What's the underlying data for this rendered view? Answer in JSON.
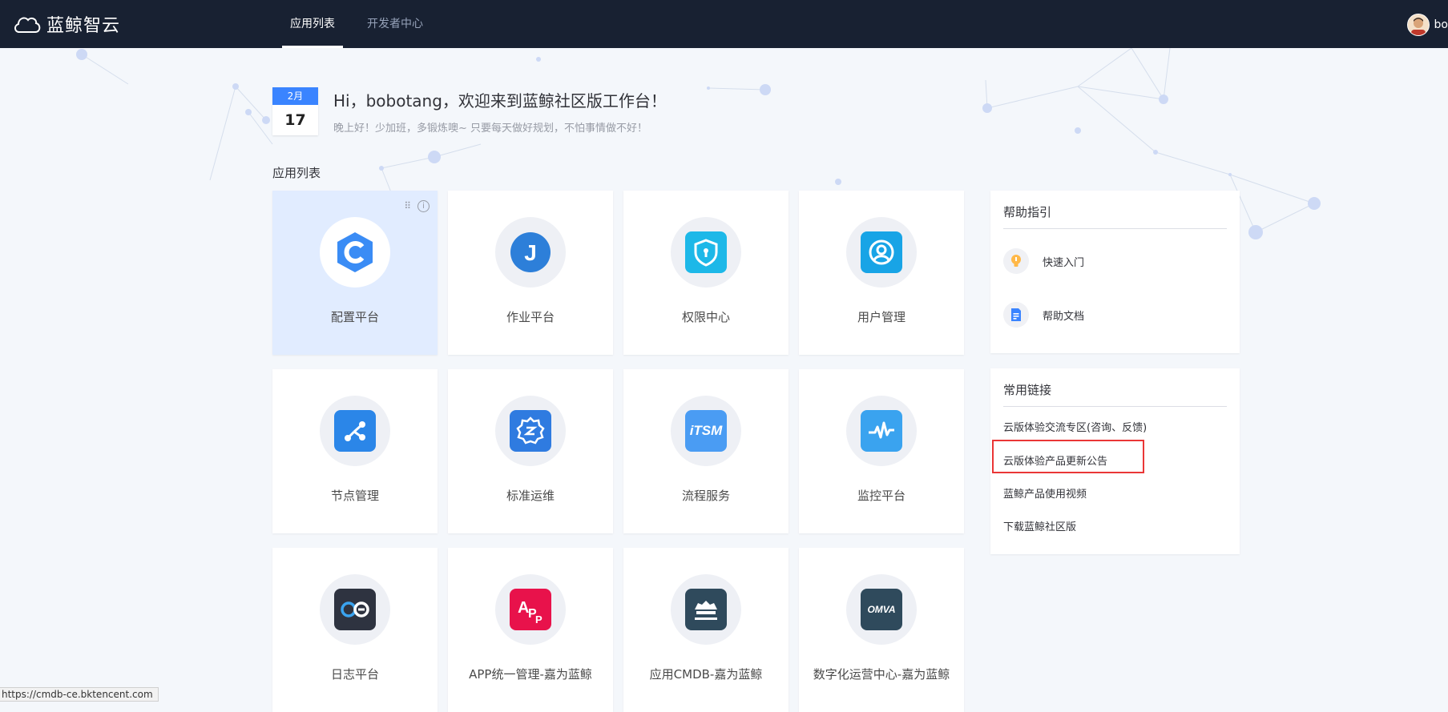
{
  "brand": {
    "name": "蓝鲸智云"
  },
  "nav": {
    "tabs": [
      {
        "label": "应用列表",
        "active": true
      },
      {
        "label": "开发者中心",
        "active": false
      }
    ]
  },
  "user": {
    "name": "bo"
  },
  "greeting": {
    "month": "2月",
    "day": "17",
    "title": "Hi，bobotang，欢迎来到蓝鲸社区版工作台！",
    "subtitle": "晚上好！少加班，多锻炼噢~ 只要每天做好规划，不怕事情做不好！"
  },
  "apps": {
    "section_title": "应用列表",
    "items": [
      {
        "name": "配置平台",
        "icon": "cmdb-icon",
        "color": "#2f8cf8"
      },
      {
        "name": "作业平台",
        "icon": "job-icon",
        "color": "#2d7fd9"
      },
      {
        "name": "权限中心",
        "icon": "iam-shield-icon",
        "color": "#1db8e8"
      },
      {
        "name": "用户管理",
        "icon": "user-manage-icon",
        "color": "#18a4e6"
      },
      {
        "name": "节点管理",
        "icon": "node-manage-icon",
        "color": "#2b86e8"
      },
      {
        "name": "标准运维",
        "icon": "sops-icon",
        "color": "#2f7be0"
      },
      {
        "name": "流程服务",
        "icon": "itsm-icon",
        "color": "#4a9cf3"
      },
      {
        "name": "监控平台",
        "icon": "monitor-icon",
        "color": "#3aa3ef"
      },
      {
        "name": "日志平台",
        "icon": "log-icon",
        "color": "#2e3340"
      },
      {
        "name": "APP统一管理-嘉为蓝鲸",
        "icon": "app-manage-icon",
        "color": "#e8124b"
      },
      {
        "name": "应用CMDB-嘉为蓝鲸",
        "icon": "app-cmdb-icon",
        "color": "#2f4a5c"
      },
      {
        "name": "数字化运营中心-嘉为蓝鲸",
        "icon": "omva-icon",
        "color": "#2f4a5c",
        "logo_text": "OMVA"
      }
    ],
    "itsm_logo_text": "iTSM"
  },
  "help": {
    "title": "帮助指引",
    "items": [
      {
        "label": "快速入门",
        "icon": "lightbulb-icon"
      },
      {
        "label": "帮助文档",
        "icon": "document-icon"
      }
    ]
  },
  "links": {
    "title": "常用链接",
    "items": [
      "云版体验交流专区(咨询、反馈)",
      "云版体验产品更新公告",
      "蓝鲸产品使用视频",
      "下载蓝鲸社区版"
    ]
  },
  "status_url": "https://cmdb-ce.bktencent.com"
}
